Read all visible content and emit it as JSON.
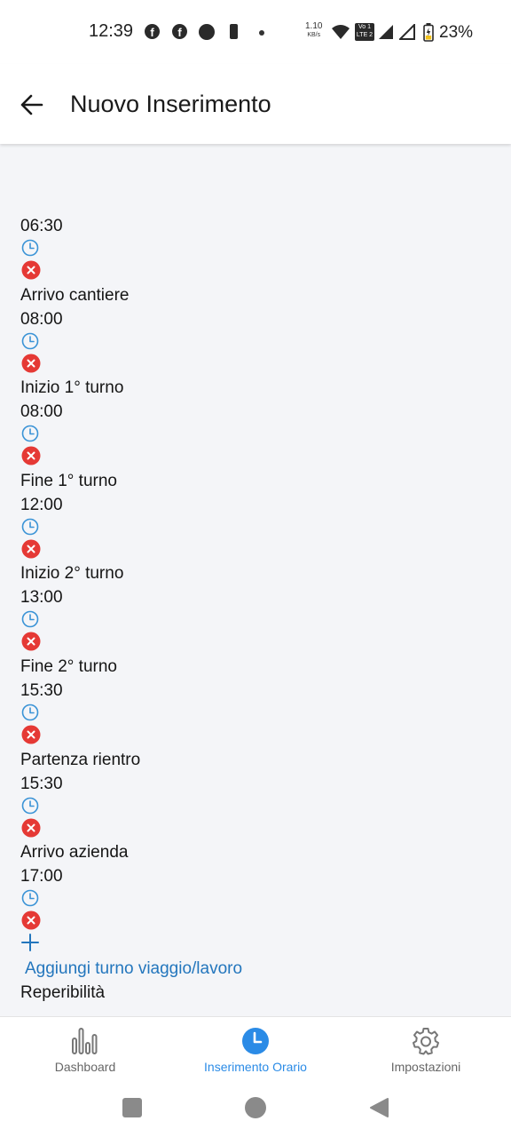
{
  "status_bar": {
    "time": "12:39",
    "speed_value": "1.10",
    "speed_unit": "KB/s",
    "volte_label_top": "Vo 1",
    "volte_label_bottom": "LTE 2",
    "battery_percent": "23%"
  },
  "app_bar": {
    "back_icon": "arrow-left-icon",
    "title": "Nuovo Inserimento"
  },
  "entries": [
    {
      "label": "",
      "time": "06:30"
    },
    {
      "label": "Arrivo cantiere",
      "time": "08:00"
    },
    {
      "label": "Inizio 1° turno",
      "time": "08:00"
    },
    {
      "label": "Fine 1° turno",
      "time": "12:00"
    },
    {
      "label": "Inizio 2° turno",
      "time": "13:00"
    },
    {
      "label": "Fine 2° turno",
      "time": "15:30"
    },
    {
      "label": "Partenza rientro",
      "time": "15:30"
    },
    {
      "label": "Arrivo azienda",
      "time": "17:00"
    }
  ],
  "add_shift": {
    "icon": "plus-icon",
    "label": "Aggiungi turno viaggio/lavoro"
  },
  "reperibilita_label": "Reperibilità",
  "bottom_nav": {
    "items": [
      {
        "label": "Dashboard",
        "icon": "bar-chart-icon",
        "active": false
      },
      {
        "label": "Inserimento Orario",
        "icon": "clock-icon",
        "active": true
      },
      {
        "label": "Impostazioni",
        "icon": "gear-icon",
        "active": false
      }
    ]
  },
  "colors": {
    "accent": "#2b8be6",
    "link": "#2376bd",
    "remove": "#e53935",
    "clock": "#3a93d6"
  }
}
